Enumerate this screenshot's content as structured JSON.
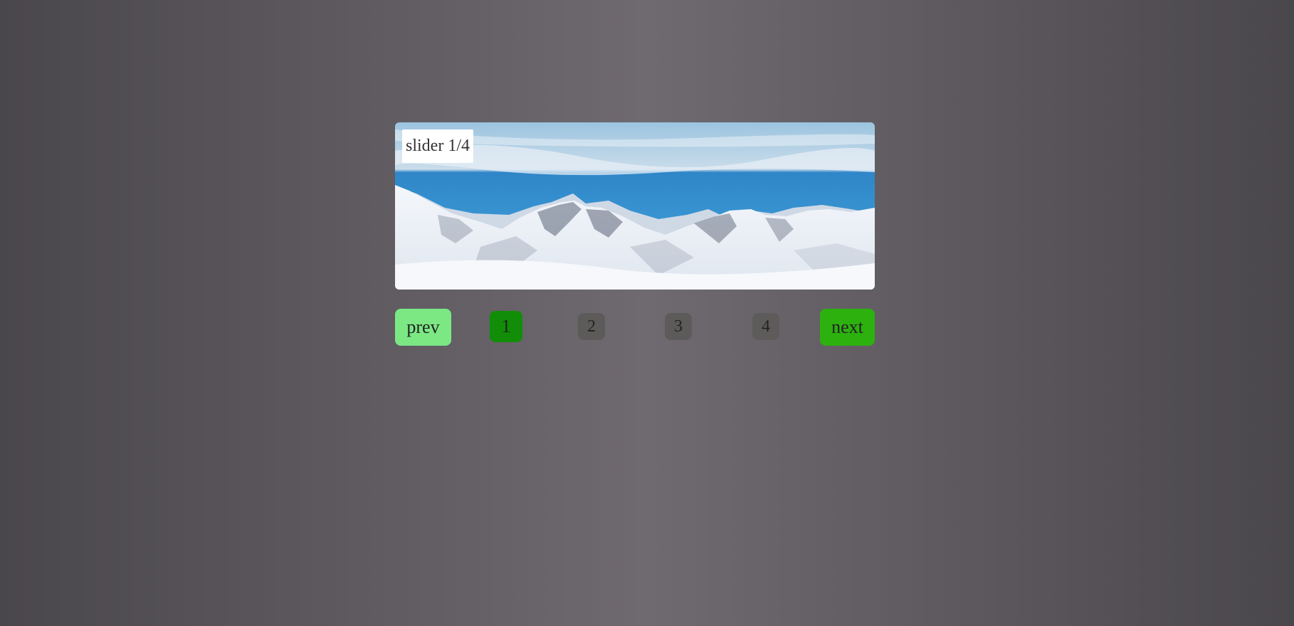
{
  "slider": {
    "caption": "slider 1/4",
    "current": 1,
    "total": 4,
    "image": "snowy-mountain-range-photo"
  },
  "controls": {
    "prev_label": "prev",
    "next_label": "next",
    "pages": [
      "1",
      "2",
      "3",
      "4"
    ]
  },
  "colors": {
    "prev_bg": "#7be884",
    "next_bg": "#2cb10f",
    "active_page_bg": "#118d08",
    "inactive_page_bg": "#5d5b5a"
  }
}
